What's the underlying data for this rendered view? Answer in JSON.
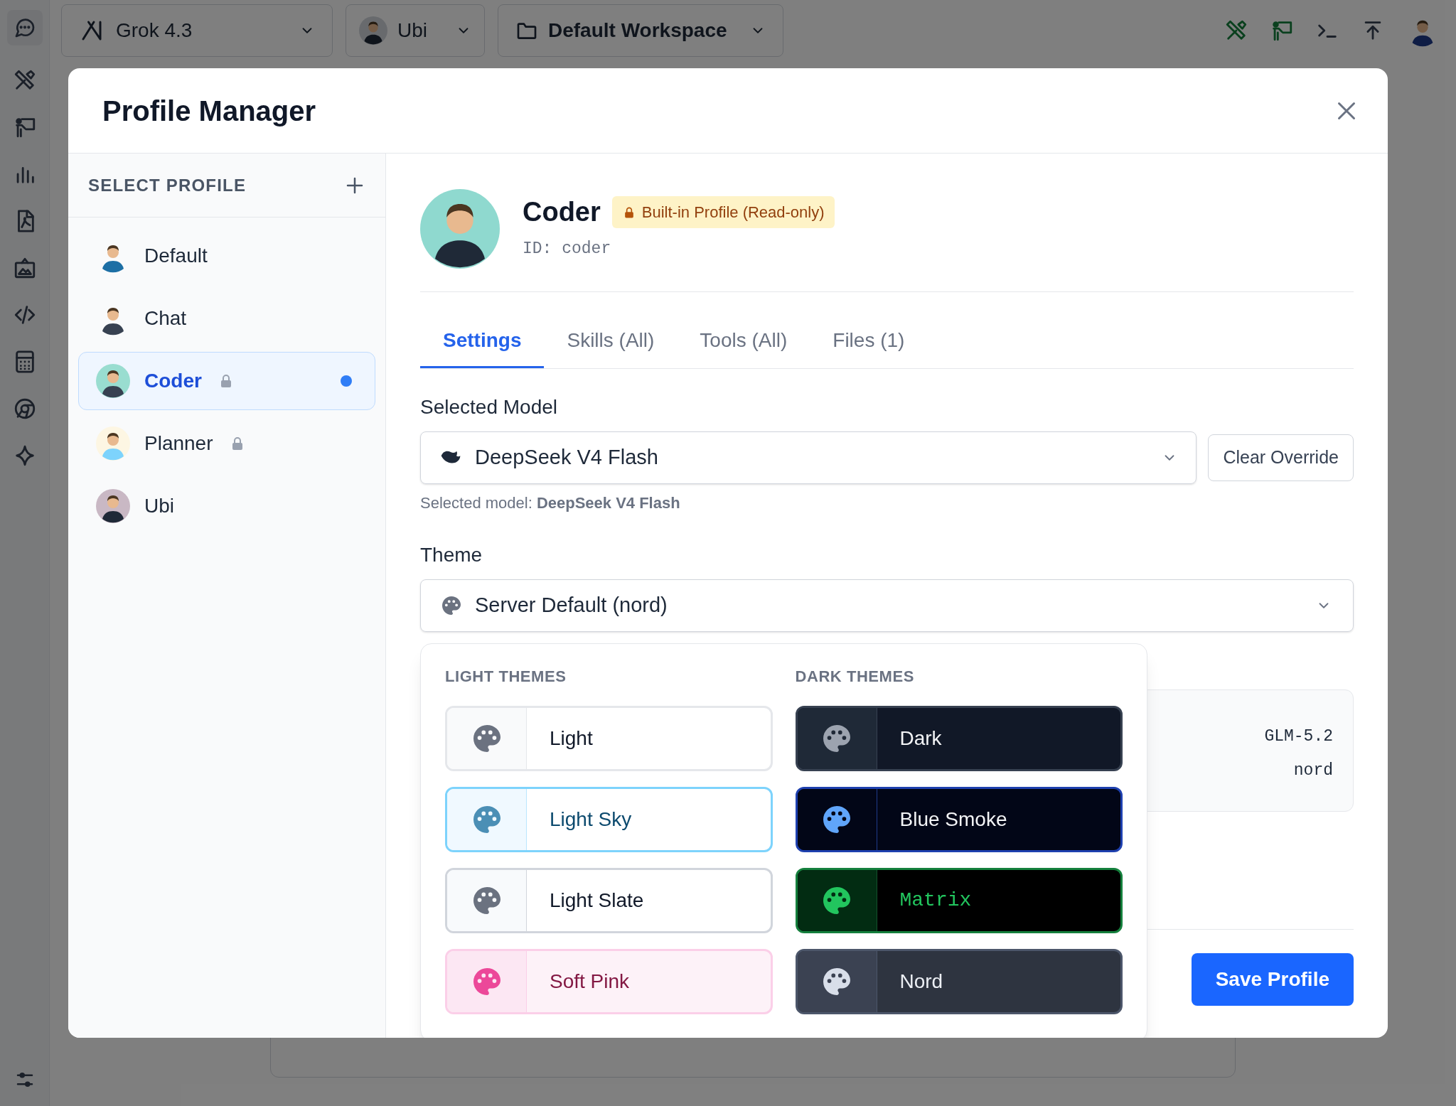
{
  "top_bar": {
    "model_selector": "Grok 4.3",
    "profile_selector": "Ubi",
    "workspace_selector": "Default Workspace"
  },
  "modal": {
    "title": "Profile Manager",
    "sidebar": {
      "heading": "SELECT PROFILE",
      "profiles": [
        {
          "name": "Default",
          "selected": false,
          "locked": false,
          "active": false
        },
        {
          "name": "Chat",
          "selected": false,
          "locked": false,
          "active": false
        },
        {
          "name": "Coder",
          "selected": true,
          "locked": true,
          "active": true
        },
        {
          "name": "Planner",
          "selected": false,
          "locked": true,
          "active": false
        },
        {
          "name": "Ubi",
          "selected": false,
          "locked": false,
          "active": false
        }
      ]
    },
    "profile": {
      "name": "Coder",
      "badge": "Built-in Profile (Read-only)",
      "id": "ID: coder"
    },
    "tabs": [
      {
        "label": "Settings",
        "selected": true
      },
      {
        "label": "Skills (All)",
        "selected": false
      },
      {
        "label": "Tools (All)",
        "selected": false
      },
      {
        "label": "Files (1)",
        "selected": false
      }
    ],
    "model": {
      "label": "Selected Model",
      "value": "DeepSeek V4 Flash",
      "clear_button": "Clear Override",
      "hint": "Selected model: **DeepSeek V4 Flash**"
    },
    "theme": {
      "label": "Theme",
      "value": "Server Default (nord)"
    },
    "summary_panel": {
      "lines": [
        "GLM-5.2",
        "nord"
      ]
    },
    "save_button": "Save Profile",
    "theme_menu": {
      "groups": [
        {
          "heading": "LIGHT THEMES",
          "themes": [
            {
              "name": "Light",
              "kind": "light",
              "color": "#6b7280"
            },
            {
              "name": "Light Sky",
              "kind": "sky",
              "color": "#4b8fb5"
            },
            {
              "name": "Light Slate",
              "kind": "slate",
              "color": "#6b7280"
            },
            {
              "name": "Soft Pink",
              "kind": "pink",
              "color": "#ec4899"
            }
          ]
        },
        {
          "heading": "DARK THEMES",
          "themes": [
            {
              "name": "Dark",
              "kind": "dark",
              "color": "#9ca3af"
            },
            {
              "name": "Blue Smoke",
              "kind": "bluesmoke",
              "color": "#60a5fa"
            },
            {
              "name": "Matrix",
              "kind": "matrix",
              "color": "#22c55e"
            },
            {
              "name": "Nord",
              "kind": "nord",
              "color": "#d8dee9"
            }
          ]
        }
      ]
    }
  }
}
